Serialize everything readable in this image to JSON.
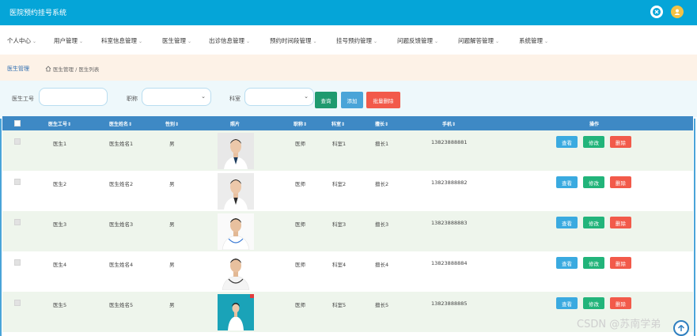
{
  "app": {
    "title": "医院预约挂号系统"
  },
  "header_icons": [
    {
      "name": "close-icon"
    },
    {
      "name": "user-avatar-icon"
    }
  ],
  "menu": [
    {
      "label": "个人中心",
      "caret": "⌄"
    },
    {
      "label": "用户管理",
      "caret": "⌄"
    },
    {
      "label": "科室信息管理",
      "caret": "⌄"
    },
    {
      "label": "医生管理",
      "caret": "⌄"
    },
    {
      "label": "出诊信息管理",
      "caret": "⌄"
    },
    {
      "label": "预约时间段管理",
      "caret": "⌄"
    },
    {
      "label": "挂号预约管理",
      "caret": "⌄"
    },
    {
      "label": "问题反馈管理",
      "caret": "⌄"
    },
    {
      "label": "问题解答管理",
      "caret": "⌄"
    },
    {
      "label": "系统管理",
      "caret": "⌄"
    }
  ],
  "breadcrumb": {
    "title": "医生管理",
    "path": "医生管理 / 医生列表"
  },
  "filters": {
    "doctor_id_label": "医生工号",
    "doctor_id_value": "",
    "title_label": "职称",
    "title_value": "",
    "dept_label": "科室",
    "dept_value": "",
    "search_button": "查询",
    "add_button": "添加",
    "batch_delete_button": "批量删除"
  },
  "table": {
    "columns": [
      "医生工号",
      "医生姓名",
      "性别",
      "照片",
      "职称",
      "科室",
      "擅长",
      "手机",
      "操作"
    ],
    "sort_marker": "⇕",
    "rows": [
      {
        "id": "医生1",
        "name": "医生姓名1",
        "gender": "男",
        "title": "医师",
        "dept": "科室1",
        "skill": "擅长1",
        "phone": "13823888881",
        "photo": "doctor-photo-1"
      },
      {
        "id": "医生2",
        "name": "医生姓名2",
        "gender": "男",
        "title": "医师",
        "dept": "科室2",
        "skill": "擅长2",
        "phone": "13823888882",
        "photo": "doctor-photo-2"
      },
      {
        "id": "医生3",
        "name": "医生姓名3",
        "gender": "男",
        "title": "医师",
        "dept": "科室3",
        "skill": "擅长3",
        "phone": "13823888883",
        "photo": "doctor-photo-3"
      },
      {
        "id": "医生4",
        "name": "医生姓名4",
        "gender": "男",
        "title": "医师",
        "dept": "科室4",
        "skill": "擅长4",
        "phone": "13823888884",
        "photo": "doctor-photo-4"
      },
      {
        "id": "医生5",
        "name": "医生姓名5",
        "gender": "男",
        "title": "医师",
        "dept": "科室5",
        "skill": "擅长5",
        "phone": "13823888885",
        "photo": "doctor-photo-5"
      }
    ],
    "row_actions": {
      "view": "查看",
      "edit": "修改",
      "delete": "删除"
    }
  },
  "watermark": "CSDN @苏南学弟",
  "colors": {
    "header": "#05a5d8",
    "table_header": "#3e89c5",
    "search_button": "#1f9a6e",
    "add_button": "#4aa4d8",
    "delete_button": "#f25a4a",
    "view_button": "#3aaae0",
    "edit_button": "#22b47a"
  }
}
